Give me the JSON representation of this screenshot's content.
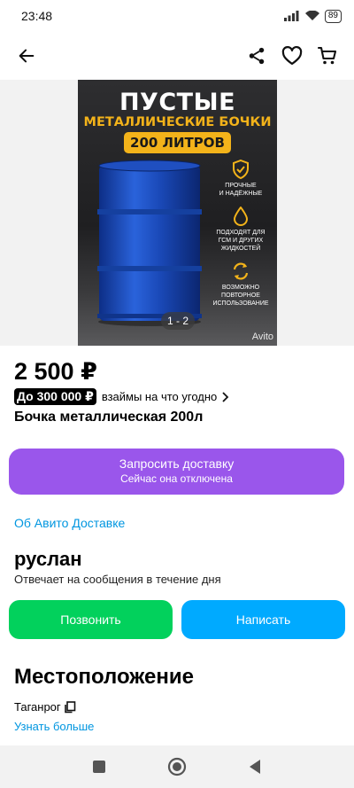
{
  "status": {
    "time": "23:48",
    "battery": "89"
  },
  "header": {
    "back_icon": "arrow-left-icon",
    "share_icon": "share-icon",
    "favorite_icon": "heart-icon",
    "cart_icon": "cart-icon"
  },
  "gallery": {
    "poster_title": "ПУСТЫЕ",
    "poster_subtitle": "МЕТАЛЛИЧЕСКИЕ БОЧКИ",
    "poster_badge": "200 ЛИТРОВ",
    "features": [
      {
        "line1": "ПРОЧНЫЕ",
        "line2": "И НАДЁЖНЫЕ",
        "line3": ""
      },
      {
        "line1": "ПОДХОДЯТ ДЛЯ",
        "line2": "ГСМ И ДРУГИХ",
        "line3": "ЖИДКОСТЕЙ"
      },
      {
        "line1": "ВОЗМОЖНО",
        "line2": "ПОВТОРНОЕ",
        "line3": "ИСПОЛЬЗОВАНИЕ"
      }
    ],
    "counter": "1 - 2",
    "watermark": "Avito",
    "colors": {
      "barrel": "#1a49b8",
      "accent": "#f3b31a"
    }
  },
  "listing": {
    "price": "2 500 ₽",
    "loan_tag": "До 300 000 ₽",
    "loan_text": "взаймы на что угодно",
    "title": "Бочка металлическая 200л"
  },
  "delivery": {
    "button_line1": "Запросить доставку",
    "button_line2": "Сейчас она отключена",
    "about_link": "Об Авито Доставке",
    "color": "#9a56eb"
  },
  "seller": {
    "name": "руслан",
    "note": "Отвечает на сообщения в течение дня",
    "call_label": "Позвонить",
    "write_label": "Написать",
    "call_color": "#02d15c",
    "write_color": "#00aaff"
  },
  "location": {
    "title": "Местоположение",
    "city": "Таганрог",
    "more_link": "Узнать больше"
  }
}
